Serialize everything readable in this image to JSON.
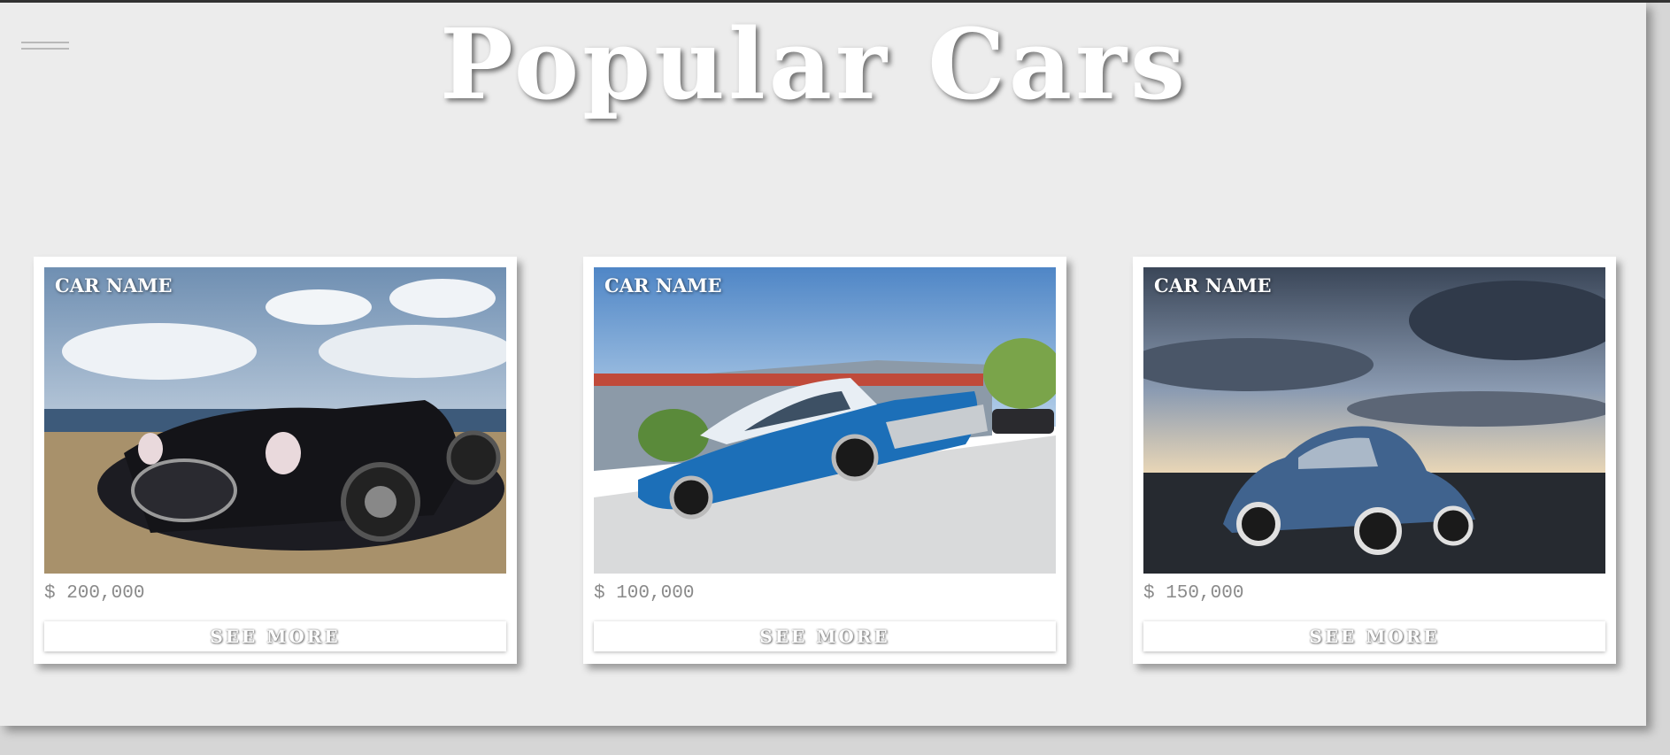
{
  "header": {
    "title": "Popular Cars",
    "menu_icon": "hamburger-menu-icon"
  },
  "cards": [
    {
      "name": "CAR NAME",
      "price": "$ 200,000",
      "button_label": "SEE MORE",
      "image": "black-roadster-on-beach"
    },
    {
      "name": "CAR NAME",
      "price": "$ 100,000",
      "button_label": "SEE MORE",
      "image": "blue-classic-sedan"
    },
    {
      "name": "CAR NAME",
      "price": "$ 150,000",
      "button_label": "SEE MORE",
      "image": "blue-beetle-at-sunset"
    }
  ],
  "colors": {
    "page_bg": "#ececec",
    "card_bg": "#ffffff",
    "price_text": "#8a8a8a"
  }
}
